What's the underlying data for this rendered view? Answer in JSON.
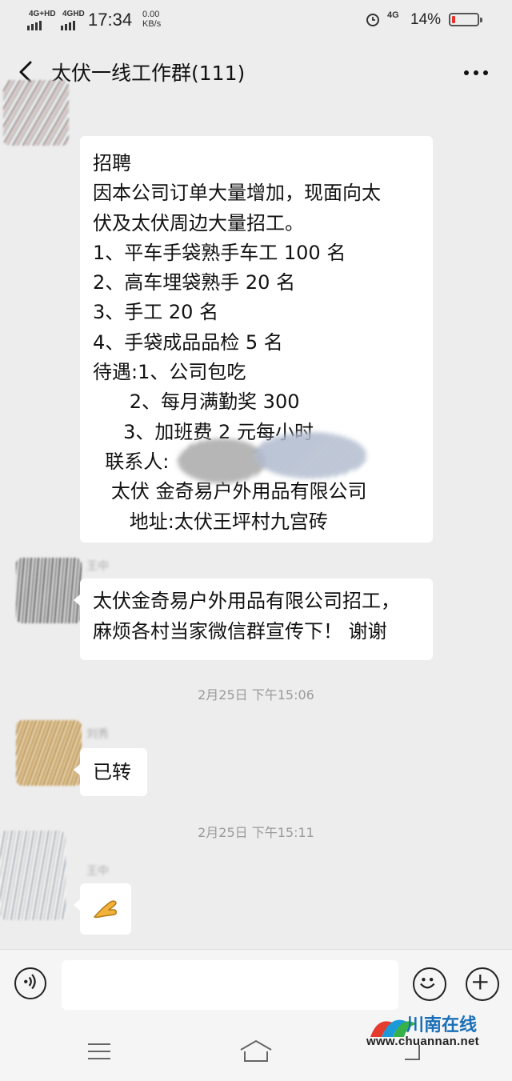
{
  "status_bar": {
    "signal1_label": "4G+HD",
    "signal2_label": "4GHD",
    "time": "17:34",
    "speed_value": "0.00",
    "speed_unit": "KB/s",
    "network": "4G",
    "battery_percent": "14%",
    "battery_level": 0.14,
    "battery_color": "#e8322e"
  },
  "header": {
    "back_icon": "chevron-left-icon",
    "title": "太伏一线工作群(111)",
    "more_icon": "more-dots-icon"
  },
  "messages": [
    {
      "lines": [
        "招聘",
        "因本公司订单大量增加，现面向太",
        "伏及太伏周边大量招工。",
        "1、平车手袋熟手车工 100 名",
        "2、高车埋袋熟手 20 名",
        "3、手工 20 名",
        "4、手袋成品品检 5 名",
        "待遇:1、公司包吃",
        "      2、每月满勤奖 300",
        "     3、加班费 2 元每小时",
        "  联系人:",
        "   太伏 金奇易户外用品有限公司",
        "      地址:太伏王坪村九宫砖"
      ]
    },
    {
      "sender": "王中",
      "lines": [
        "太伏金奇易户外用品有限公司招工，",
        "麻烦各村当家微信群宣传下！ 谢谢"
      ]
    },
    {
      "timestamp": "2月25日  下午15:06"
    },
    {
      "sender": "刘秀",
      "text": "已转"
    },
    {
      "timestamp": "2月25日  下午15:11"
    },
    {
      "sender": "王中",
      "emoji": "ok-hand-emoji"
    }
  ],
  "input_bar": {
    "voice_icon": "voice-icon",
    "emoji_icon": "emoji-icon",
    "plus_icon": "plus-icon",
    "draft": ""
  },
  "nav_bar": {
    "menu_icon": "menu-icon",
    "home_icon": "home-icon",
    "back_icon": "back-icon"
  },
  "watermark": {
    "text": "川南在线",
    "url": "www.chuannan.net"
  }
}
